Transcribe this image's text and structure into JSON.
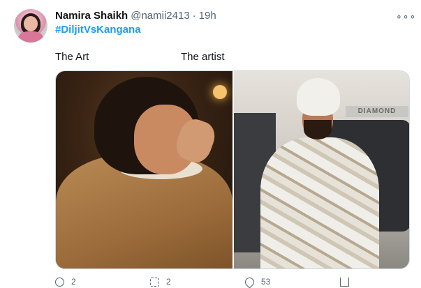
{
  "tweet": {
    "author_name": "Namira Shaikh",
    "handle": "@namii2413",
    "separator": "·",
    "time": "19h",
    "more_icon": "more-horizontal-icon",
    "hashtag": "#DiljitVsKangana"
  },
  "media": {
    "left_caption": "The Art",
    "right_caption": "The artist",
    "right_image_text": "DIAMOND"
  },
  "actions": {
    "reply_count": "2",
    "retweet_count": "2",
    "like_count": "53"
  },
  "colors": {
    "link": "#1d9bf0",
    "secondary_text": "#536471",
    "primary_text": "#0f1419",
    "border": "#cfd9de"
  }
}
